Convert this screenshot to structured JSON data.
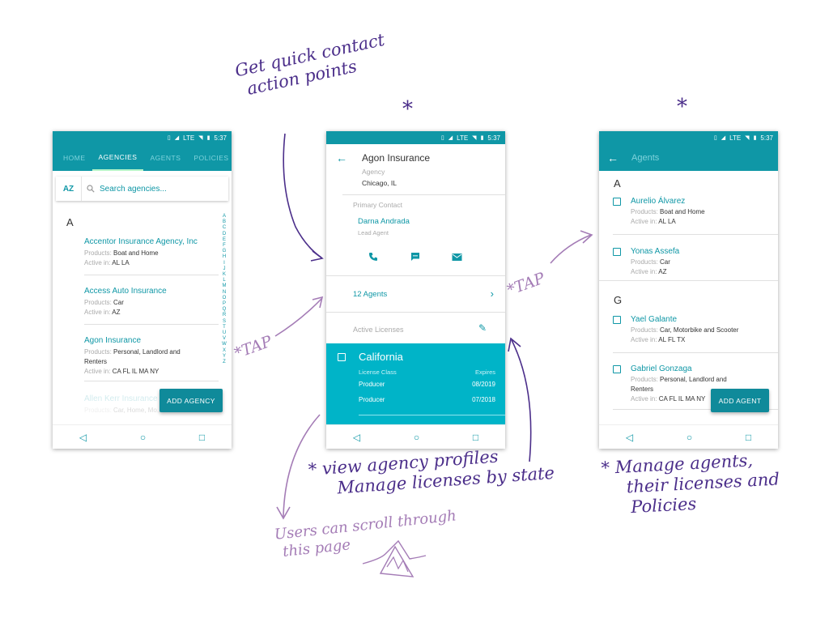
{
  "status": {
    "network": "LTE",
    "time": "5:37"
  },
  "screen1": {
    "tabs": [
      "HOME",
      "AGENCIES",
      "AGENTS",
      "POLICIES"
    ],
    "search": {
      "sort_label": "AZ",
      "placeholder": "Search agencies..."
    },
    "section_letter": "A",
    "index_letters": "A B C D E F G H I J K L M N O P Q R S T U V W X Y Z",
    "agencies": [
      {
        "name": "Accentor Insurance Agency, Inc",
        "products_label": "Products:",
        "products": "Boat and Home",
        "active_label": "Active in:",
        "active": "AL  LA"
      },
      {
        "name": "Access Auto Insurance",
        "products_label": "Products:",
        "products": "Car",
        "active_label": "Active in:",
        "active": "AZ"
      },
      {
        "name": "Agon Insurance",
        "products_label": "Products:",
        "products": "Personal, Landlord and Renters",
        "active_label": "Active in:",
        "active": "CA  FL IL  MA  NY"
      },
      {
        "name": "Allen Kerr Insurance",
        "products_label": "Products:",
        "products": "Car, Home, Mo..."
      }
    ],
    "fab_label": "ADD AGENCY"
  },
  "screen2": {
    "title": "Agon Insurance",
    "subtitle": "Agency",
    "location": "Chicago, IL",
    "primary_contact_label": "Primary Contact",
    "contact_name": "Darna Andrada",
    "contact_role": "Lead Agent",
    "agents_link": "12 Agents",
    "active_licenses_label": "Active Licenses",
    "license": {
      "state": "California",
      "class_header": "License Class",
      "expires_header": "Expires",
      "rows": [
        {
          "class": "Producer",
          "expires": "08/2019"
        },
        {
          "class": "Producer",
          "expires": "07/2018"
        }
      ]
    }
  },
  "screen3": {
    "title": "Agents",
    "groups": [
      {
        "letter": "A",
        "agents": [
          {
            "name": "Aurelio Álvarez",
            "products_label": "Products:",
            "products": "Boat and Home",
            "active_label": "Active in:",
            "active": "AL  LA"
          },
          {
            "name": "Yonas Assefa",
            "products_label": "Products:",
            "products": "Car",
            "active_label": "Active in:",
            "active": "AZ"
          }
        ]
      },
      {
        "letter": "G",
        "agents": [
          {
            "name": "Yael Galante",
            "products_label": "Products:",
            "products": "Car, Motorbike and Scooter",
            "active_label": "Active in:",
            "active": "AL  FL TX"
          },
          {
            "name": "Gabriel Gonzaga",
            "products_label": "Products:",
            "products": "Personal, Landlord and Renters",
            "active_label": "Active in:",
            "active": "CA  FL IL  MA  NY"
          }
        ]
      }
    ],
    "fab_label": "ADD AGENT"
  },
  "notes": {
    "quick_contact_1": "Get quick contact",
    "quick_contact_2": "action points",
    "tap1": "*TAP",
    "tap2": "*TAP",
    "star_mid": "*",
    "star_right": "*",
    "profiles_1": "* view agency profiles",
    "profiles_2": "Manage licenses by state",
    "manage_1": "* Manage agents,",
    "manage_2": "their licenses and",
    "manage_3": "Policies",
    "scroll_1": "Users can scroll through",
    "scroll_2": "this page"
  },
  "colors": {
    "teal": "#0f97a6",
    "license_bg": "#00b4c8",
    "ink_purple": "#4b2e8a",
    "ink_lilac": "#a47cb6"
  }
}
